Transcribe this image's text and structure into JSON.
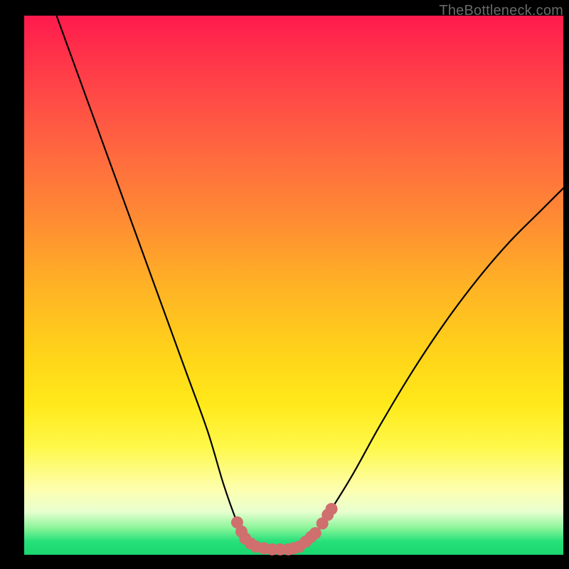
{
  "watermark": "TheBottleneck.com",
  "chart_data": {
    "type": "line",
    "title": "",
    "xlabel": "",
    "ylabel": "",
    "xlim": [
      0,
      100
    ],
    "ylim": [
      0,
      100
    ],
    "series": [
      {
        "name": "bottleneck-curve",
        "x": [
          6,
          10,
          14,
          18,
          22,
          26,
          30,
          34,
          37,
          39.5,
          41,
          43,
          46,
          49,
          51,
          54,
          57,
          61,
          66,
          72,
          78,
          84,
          90,
          96,
          100
        ],
        "values": [
          100,
          89,
          78,
          67,
          56,
          45,
          34,
          23,
          13,
          6,
          3,
          1.5,
          1,
          1,
          1.5,
          4,
          8.5,
          15,
          24,
          34,
          43,
          51,
          58,
          64,
          68
        ],
        "color": "#000000"
      }
    ],
    "markers": {
      "name": "highlight-dots",
      "color": "#cf6f6e",
      "radius_px": 8.5,
      "points": [
        {
          "x": 39.5,
          "y": 6.0
        },
        {
          "x": 40.3,
          "y": 4.3
        },
        {
          "x": 41.0,
          "y": 3.0
        },
        {
          "x": 42.0,
          "y": 2.1
        },
        {
          "x": 43.0,
          "y": 1.5
        },
        {
          "x": 44.5,
          "y": 1.2
        },
        {
          "x": 46.0,
          "y": 1.0
        },
        {
          "x": 47.5,
          "y": 1.0
        },
        {
          "x": 49.0,
          "y": 1.0
        },
        {
          "x": 50.0,
          "y": 1.2
        },
        {
          "x": 51.0,
          "y": 1.5
        },
        {
          "x": 52.2,
          "y": 2.4
        },
        {
          "x": 53.2,
          "y": 3.3
        },
        {
          "x": 54.0,
          "y": 4.0
        },
        {
          "x": 55.3,
          "y": 5.8
        },
        {
          "x": 56.3,
          "y": 7.4
        },
        {
          "x": 57.0,
          "y": 8.5
        }
      ]
    },
    "background_gradient": {
      "stops": [
        {
          "pct": 0,
          "color": "#ff1a4d"
        },
        {
          "pct": 14,
          "color": "#ff4747"
        },
        {
          "pct": 38,
          "color": "#ff8c33"
        },
        {
          "pct": 62,
          "color": "#ffd21a"
        },
        {
          "pct": 88,
          "color": "#fdffb0"
        },
        {
          "pct": 97,
          "color": "#26e07a"
        },
        {
          "pct": 100,
          "color": "#1ad66e"
        }
      ]
    }
  }
}
